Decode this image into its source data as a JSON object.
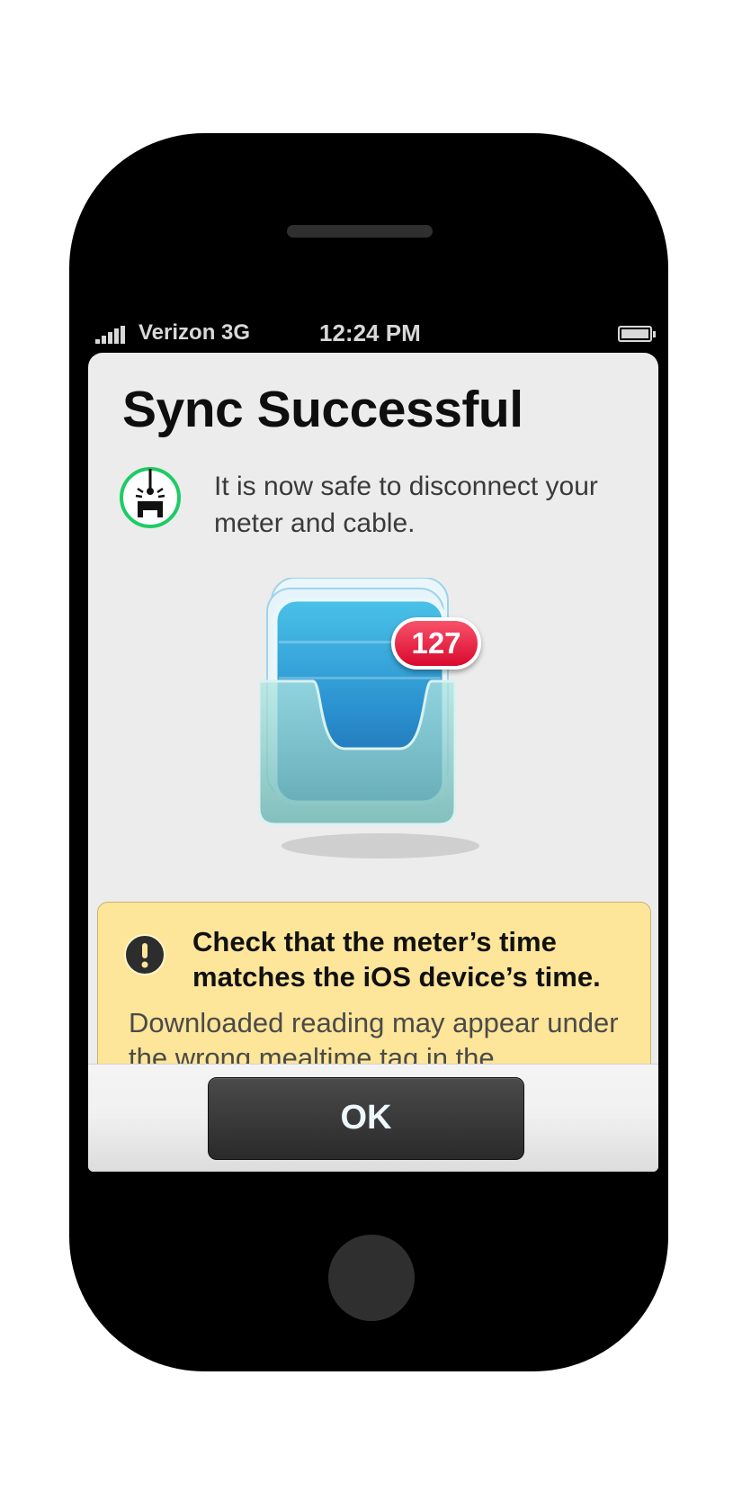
{
  "status_bar": {
    "carrier": "Verizon  3G",
    "time": "12:24 PM",
    "signal_icon": "signal-bars-icon",
    "battery_icon": "battery-icon"
  },
  "dialog": {
    "title": "Sync Successful",
    "info_icon": "cable-disconnect-icon",
    "info_text": "It is now safe to disconnect your meter and cable.",
    "illustration_icon": "readings-tray-icon",
    "badge_count": "127",
    "warning": {
      "icon": "exclamation-icon",
      "heading": "Check that the meter’s time matches the iOS device’s time.",
      "body": "Downloaded reading may appear under the wrong mealtime tag in the"
    },
    "ok_label": "OK"
  },
  "colors": {
    "accent_green": "#1ecb66",
    "badge_red": "#e4153a",
    "warning_bg": "#fde599",
    "button_dark": "#333333"
  }
}
